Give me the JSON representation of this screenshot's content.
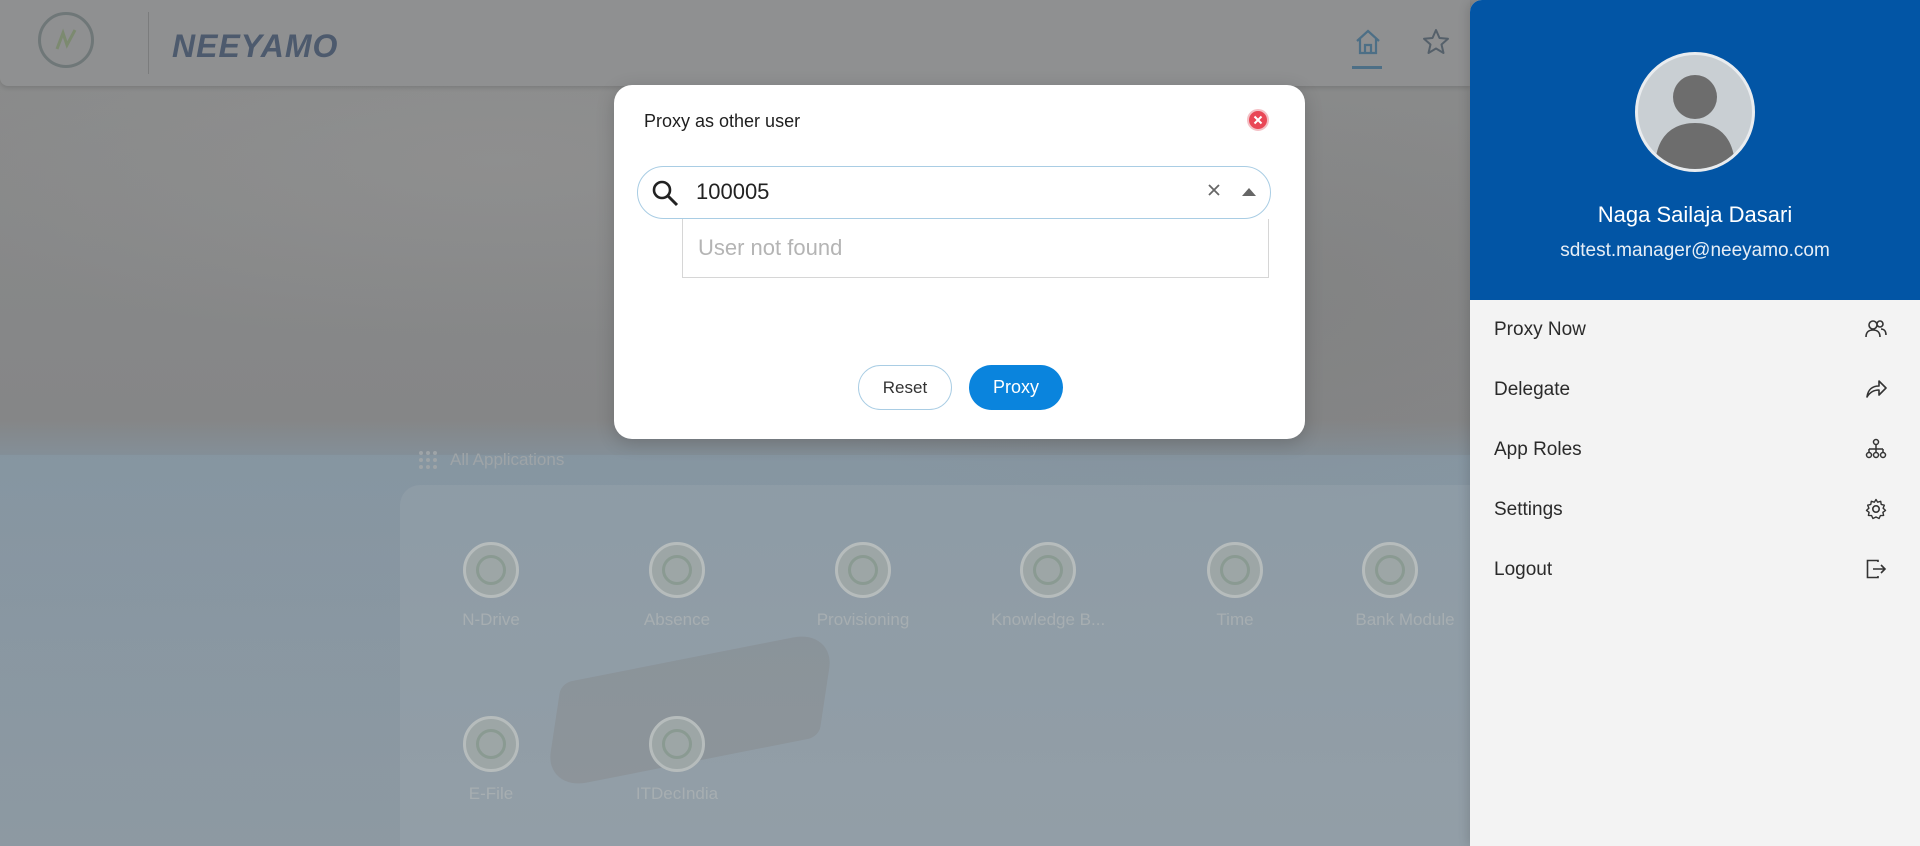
{
  "header": {
    "brand": "NEEYAMO"
  },
  "background_apps": {
    "section_title": "All Applications",
    "apps": [
      {
        "label": "N-Drive"
      },
      {
        "label": "Absence"
      },
      {
        "label": "Provisioning"
      },
      {
        "label": "Knowledge B..."
      },
      {
        "label": "Time"
      },
      {
        "label": "Bank Module"
      },
      {
        "label": "E-File"
      },
      {
        "label": "ITDecIndia"
      }
    ]
  },
  "dialog": {
    "title": "Proxy as other user",
    "search_value": "100005",
    "dropdown_message": "User not found",
    "reset_label": "Reset",
    "proxy_label": "Proxy"
  },
  "profile": {
    "name": "Naga Sailaja Dasari",
    "email": "sdtest.manager@neeyamo.com"
  },
  "menu": {
    "items": [
      {
        "label": "Proxy Now",
        "icon": "users-icon"
      },
      {
        "label": "Delegate",
        "icon": "share-arrow-icon"
      },
      {
        "label": "App Roles",
        "icon": "hierarchy-icon"
      },
      {
        "label": "Settings",
        "icon": "gear-icon"
      },
      {
        "label": "Logout",
        "icon": "logout-icon"
      }
    ]
  },
  "colors": {
    "primary_blue": "#0255a5",
    "button_blue": "#0a84dd",
    "close_red": "#e94756"
  }
}
